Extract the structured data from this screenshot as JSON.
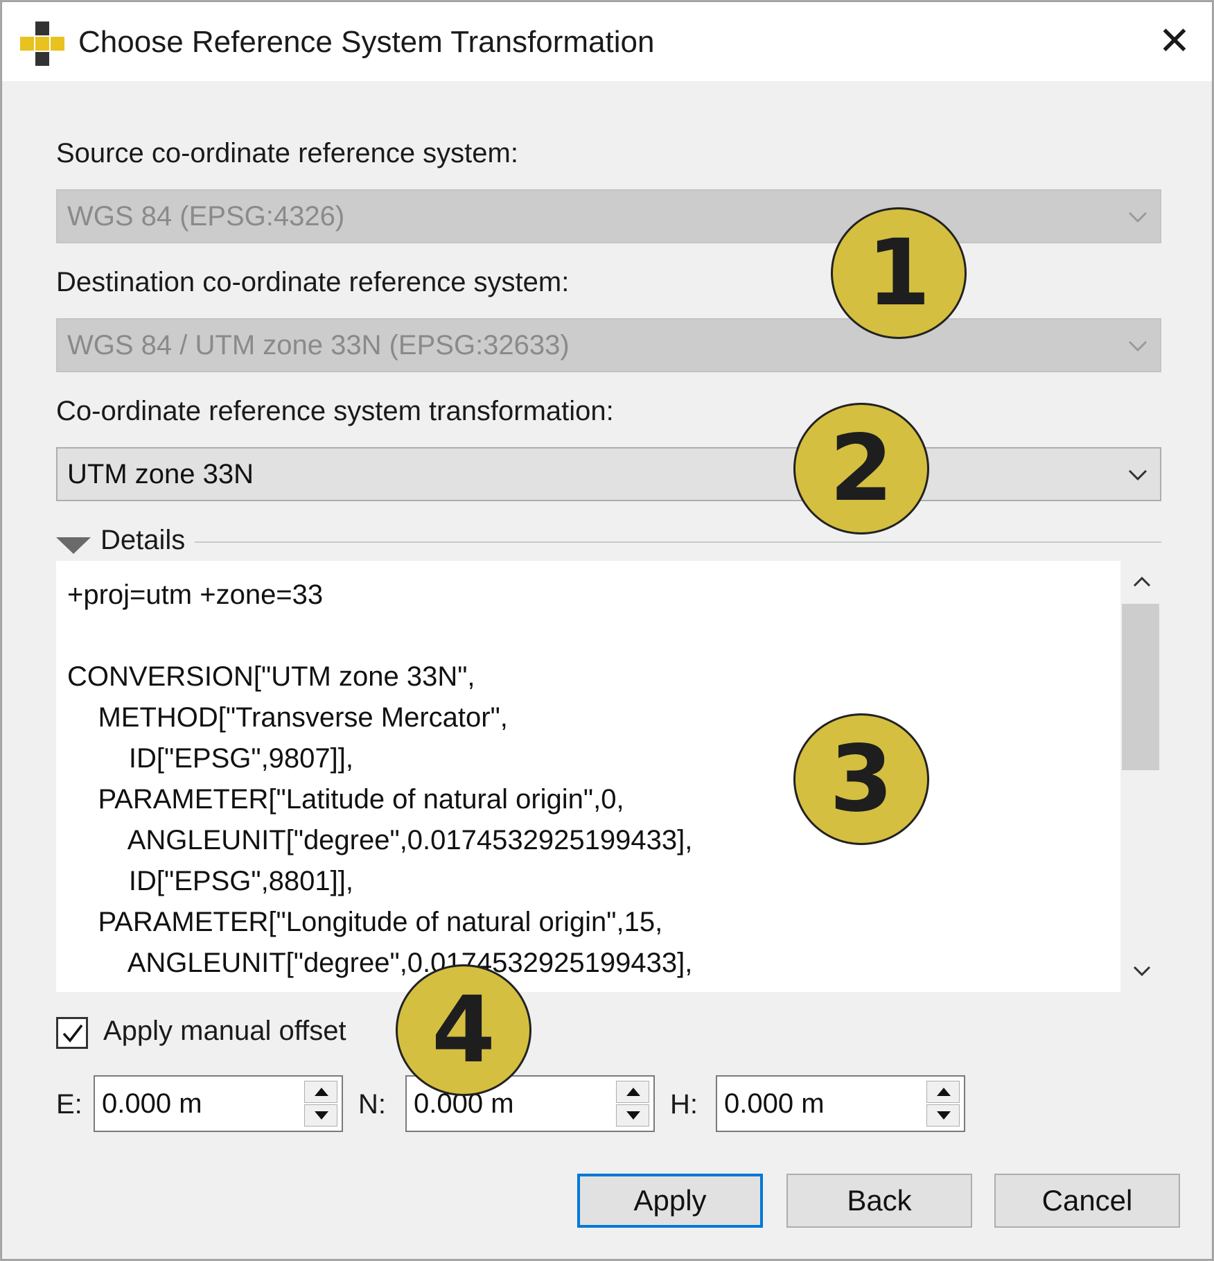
{
  "window": {
    "title": "Choose Reference System Transformation",
    "close_glyph": "✕"
  },
  "source": {
    "label": "Source co-ordinate reference system:",
    "value": "WGS 84 (EPSG:4326)"
  },
  "destination": {
    "label": "Destination co-ordinate reference system:",
    "value": "WGS 84 / UTM zone 33N (EPSG:32633)"
  },
  "transformation": {
    "label": "Co-ordinate reference system transformation:",
    "value": "UTM zone 33N"
  },
  "details": {
    "label": "Details",
    "text": "+proj=utm +zone=33\n\nCONVERSION[\"UTM zone 33N\",\n    METHOD[\"Transverse Mercator\",\n        ID[\"EPSG\",9807]],\n    PARAMETER[\"Latitude of natural origin\",0,\n        ANGLEUNIT[\"degree\",0.0174532925199433],\n        ID[\"EPSG\",8801]],\n    PARAMETER[\"Longitude of natural origin\",15,\n        ANGLEUNIT[\"degree\",0.0174532925199433],"
  },
  "offset": {
    "checkbox_label": "Apply manual offset",
    "checked": true,
    "e_label": "E:",
    "e_value": "0.000 m",
    "n_label": "N:",
    "n_value": "0.000 m",
    "h_label": "H:",
    "h_value": "0.000 m"
  },
  "buttons": {
    "apply": "Apply",
    "back": "Back",
    "cancel": "Cancel"
  },
  "callouts": [
    "1",
    "2",
    "3",
    "4"
  ],
  "colors": {
    "callout_fill": "#d4bf40",
    "default_button_border": "#0078d7",
    "app_icon_yellow": "#e8c21e"
  }
}
